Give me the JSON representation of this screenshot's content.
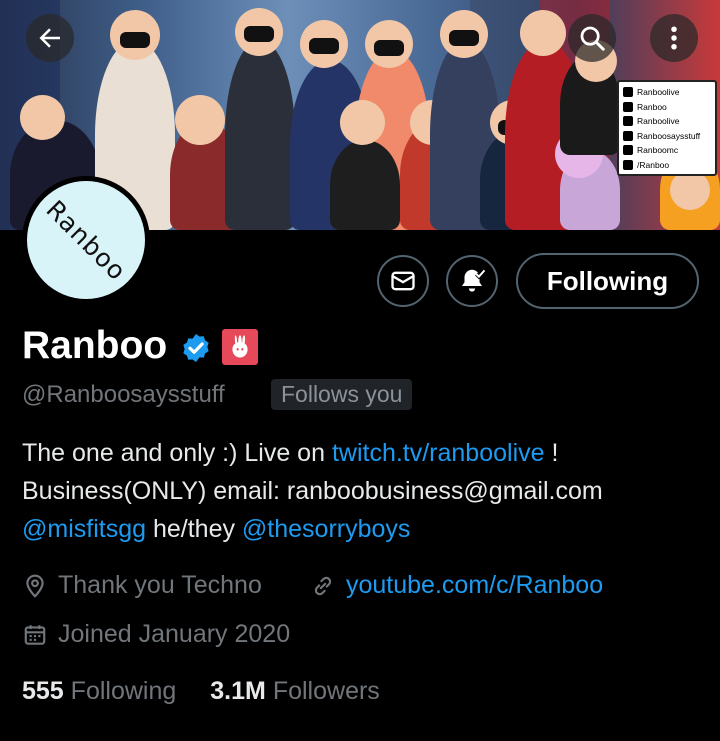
{
  "banner": {
    "social_card": [
      {
        "icon": "twitch-icon",
        "text": "Ranboolive"
      },
      {
        "icon": "youtube-icon",
        "text": "Ranboo"
      },
      {
        "icon": "tiktok-icon",
        "text": "Ranboolive"
      },
      {
        "icon": "twitter-icon",
        "text": "Ranboosaysstuff"
      },
      {
        "icon": "instagram-icon",
        "text": "Ranboomc"
      },
      {
        "icon": "discord-icon",
        "text": "/Ranboo"
      }
    ]
  },
  "avatar": {
    "text": "Ranboo",
    "background": "#d9f4f8"
  },
  "actions": {
    "follow_label": "Following"
  },
  "profile": {
    "name": "Ranboo",
    "handle": "@Ranboosaysstuff",
    "follows_you": "Follows you",
    "bio": {
      "line1_text": "The one and only :) Live on ",
      "line1_link": "twitch.tv/ranboolive",
      "line1_end": " !",
      "line2": "Business(ONLY) email: ranboobusiness@gmail.com",
      "line3_mention1": "@misfitsgg",
      "line3_middle": " he/they ",
      "line3_mention2": "@thesorryboys"
    },
    "location": "Thank you Techno",
    "website": "youtube.com/c/Ranboo",
    "joined": "Joined January 2020",
    "following_count": "555",
    "following_label": "Following",
    "followers_count": "3.1M",
    "followers_label": "Followers"
  },
  "colors": {
    "accent": "#1d9bf0",
    "verified": "#1d9bf0",
    "secondary_text": "#71767b"
  }
}
